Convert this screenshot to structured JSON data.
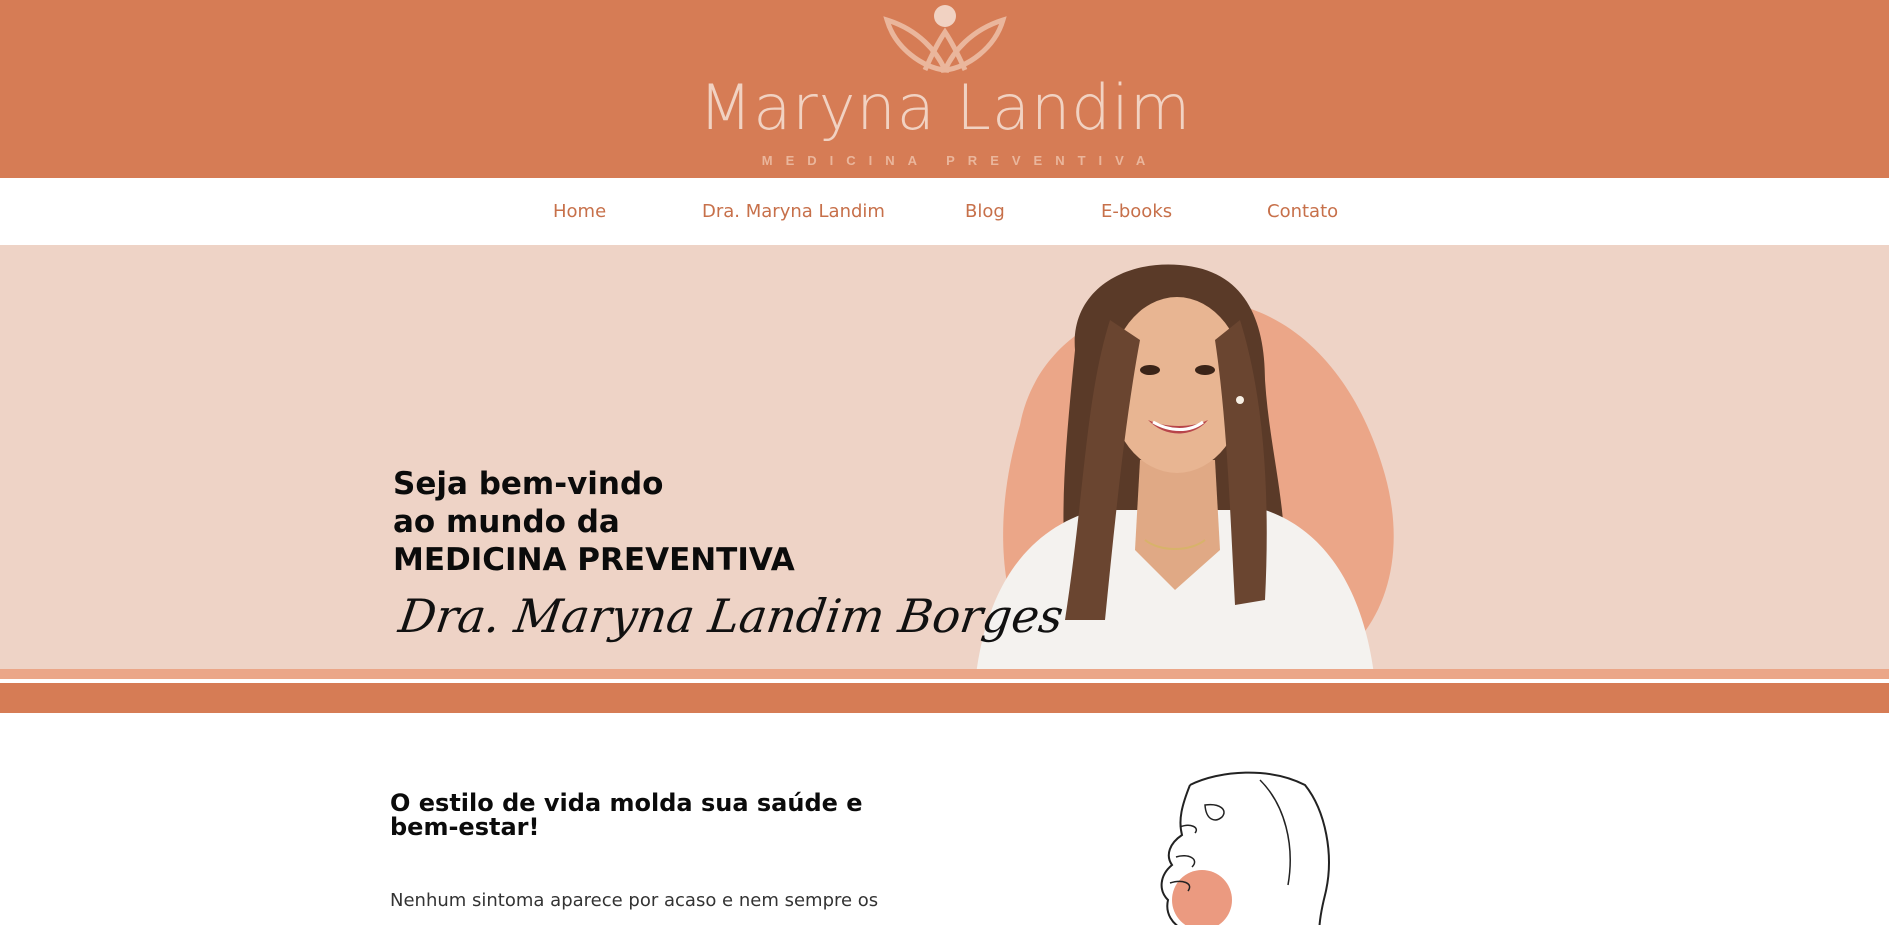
{
  "header": {
    "brand_name": "Maryna Landim",
    "brand_tagline": "MEDICINA PREVENTIVA",
    "colors": {
      "background": "#d67c55",
      "logo": "#f1d2c2",
      "tagline": "#eab69c"
    }
  },
  "nav": {
    "items": [
      {
        "label": "Home"
      },
      {
        "label": "Dra. Maryna Landim"
      },
      {
        "label": "Blog"
      },
      {
        "label": "E-books"
      },
      {
        "label": "Contato"
      }
    ],
    "color": "#c7704a"
  },
  "hero": {
    "lines": [
      "Seja bem-vindo",
      "ao mundo da",
      "MEDICINA PREVENTIVA"
    ],
    "signature": "Dra. Maryna Landim Borges",
    "colors": {
      "background": "#eed3c6",
      "blob": "#eba688",
      "band": "#d67c55"
    }
  },
  "section": {
    "title": "O estilo de vida molda sua saúde e bem-estar!",
    "paragraph": "Nenhum sintoma aparece por acaso e nem sempre os"
  }
}
